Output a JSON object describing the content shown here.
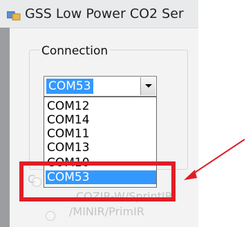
{
  "window": {
    "title": "GSS Low Power CO2 Ser",
    "icon": "app-window-icon"
  },
  "connection_group": {
    "label": "Connection",
    "port_combo": {
      "selected": "COM53",
      "dropdown_icon": "chevron-down-icon",
      "options": [
        "COM12",
        "COM14",
        "COM11",
        "COM13",
        "COM10",
        "COM53"
      ],
      "highlighted": "COM53"
    }
  },
  "sensor_options": {
    "option_partial": "C",
    "option2_line1": "COZIR-W/SprintIR",
    "option2_line2": "/MINIR/PrimIR"
  },
  "annotation": {
    "box_color": "#e01e26",
    "arrow_color": "#e01e26"
  }
}
